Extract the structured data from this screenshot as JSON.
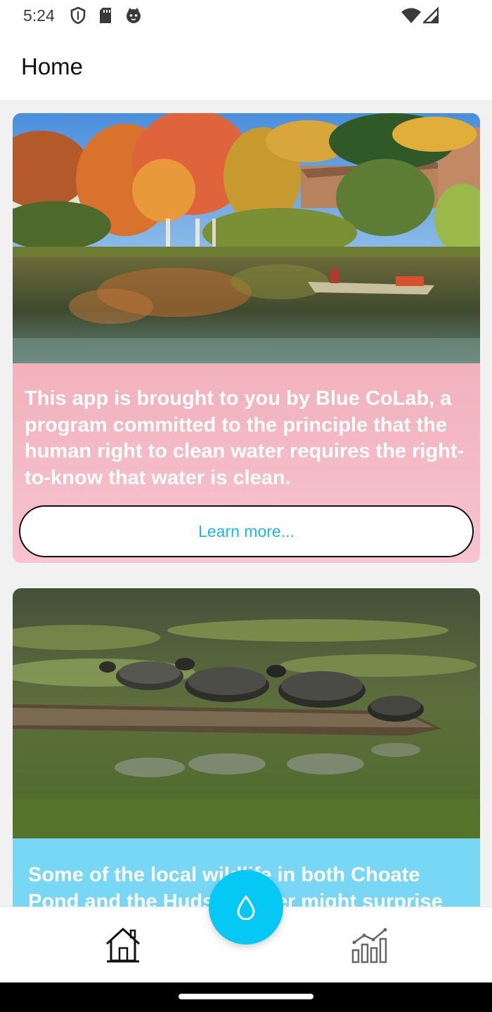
{
  "status_bar": {
    "time": "5:24",
    "icons": [
      "shield-icon",
      "sd-card-icon",
      "cat-icon",
      "wifi-icon",
      "signal-icon"
    ]
  },
  "app_bar": {
    "title": "Home"
  },
  "cards": [
    {
      "image": "autumn pond with rowboat",
      "text": "This app is brought to you by Blue CoLab, a program committed to the principle that the human right to clean water requires the right-to-know that water is clean.",
      "button_label": "Learn more...",
      "color_top": "#e99aa6",
      "color_bottom": "#f7c4cf"
    },
    {
      "image": "turtles on a log",
      "text": "Some of the local wildlife in both Choate Pond and the Hudson River might surprise",
      "color": "#79d7f6"
    }
  ],
  "bottom_nav": {
    "items": [
      "home-icon",
      "stats-chart-icon"
    ],
    "fab_icon": "water-drop-icon",
    "fab_color": "#06c8f5"
  }
}
